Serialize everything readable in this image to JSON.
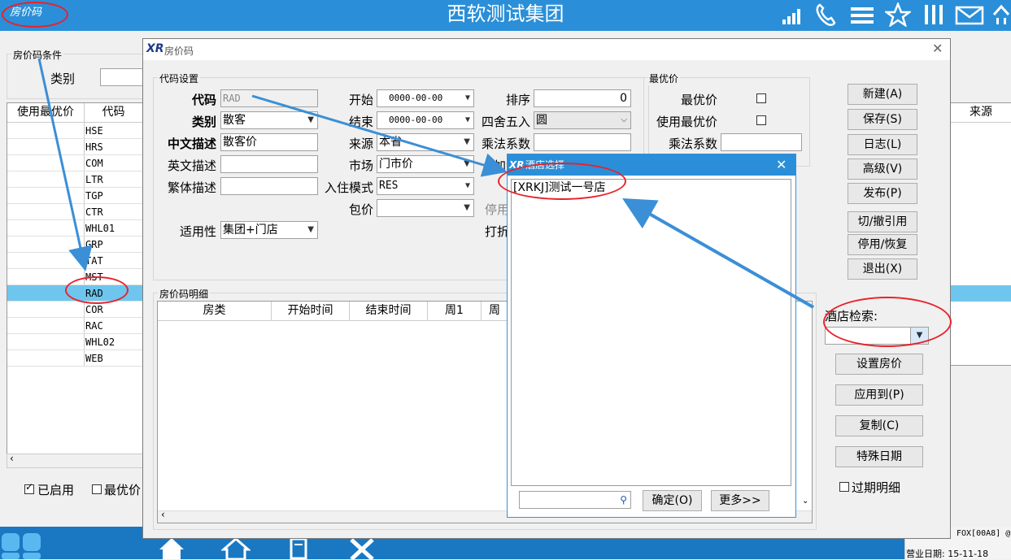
{
  "topbar": {
    "title": "西软测试集团",
    "left_label": "房价码",
    "icons": [
      "signal-icon",
      "phone-icon",
      "menu-icon",
      "star-icon",
      "columns-icon",
      "mail-icon",
      "home-up-icon"
    ]
  },
  "bg": {
    "conditions_label": "房价码条件",
    "category_label": "类别",
    "grid_headers": [
      "使用最优价",
      "代码"
    ],
    "grid_header_right": "来源",
    "codes": [
      "HSE",
      "HRS",
      "COM",
      "LTR",
      "TGP",
      "CTR",
      "WHL01",
      "GRP",
      "TAT",
      "MST",
      "RAD",
      "COR",
      "RAC",
      "WHL02",
      "WEB"
    ],
    "selected_code": "RAD",
    "chk_enabled": "已启用",
    "chk_best": "最优价",
    "footer_right_1": "FOX[00A8] @",
    "footer_right_2": "营业日期: 15-11-18"
  },
  "dialog": {
    "title": "房价码",
    "logo": "XR",
    "group_code_settings": "代码设置",
    "group_best_price": "最优价",
    "group_detail": "房价码明细",
    "fields": {
      "code_label": "代码",
      "code_value": "RAD",
      "category_label": "类别",
      "category_value": "散客",
      "cn_desc_label": "中文描述",
      "cn_desc_value": "散客价",
      "en_desc_label": "英文描述",
      "en_desc_value": "",
      "tw_desc_label": "繁体描述",
      "tw_desc_value": "",
      "applicable_label": "适用性",
      "applicable_value": "集团+门店",
      "start_label": "开始",
      "start_value": "0000-00-00",
      "end_label": "结束",
      "end_value": "0000-00-00",
      "source_label": "来源",
      "source_value": "本省",
      "market_label": "市场",
      "market_value": "门市价",
      "checkin_label": "入住模式",
      "checkin_value": "RES",
      "package_label": "包价",
      "package_value": "",
      "sort_label": "排序",
      "sort_value": "0",
      "round_label": "四舍五入",
      "round_value": "圆",
      "multiply_label": "乘法系数",
      "add_label": "加法系",
      "disable_label": "停用",
      "discount_label": "打折",
      "best_price_label": "最优价",
      "use_best_label": "使用最优价",
      "best_multiply_label": "乘法系数"
    },
    "detail_headers": [
      "房类",
      "开始时间",
      "结束时间",
      "周1",
      "周"
    ],
    "buttons": {
      "new": "新建(A)",
      "save": "保存(S)",
      "log": "日志(L)",
      "advanced": "高级(V)",
      "publish": "发布(P)",
      "cut": "切/撤引用",
      "disable": "停用/恢复",
      "exit": "退出(X)",
      "set_price": "设置房价",
      "apply_to": "应用到(P)",
      "copy": "复制(C)",
      "special_date": "特殊日期"
    },
    "hotel_search_label": "酒店检索:",
    "expired_detail": "过期明细"
  },
  "popup": {
    "logo": "XR",
    "title": "酒店选择",
    "items": [
      "[XRKJ]测试一号店"
    ],
    "ok_button": "确定(O)",
    "more_button": "更多>>"
  },
  "colors": {
    "accent": "#2a8fd8",
    "selected_row": "#6ec6ee",
    "annotation_red": "#e8222a",
    "annotation_arrow": "#3b8fd6"
  }
}
